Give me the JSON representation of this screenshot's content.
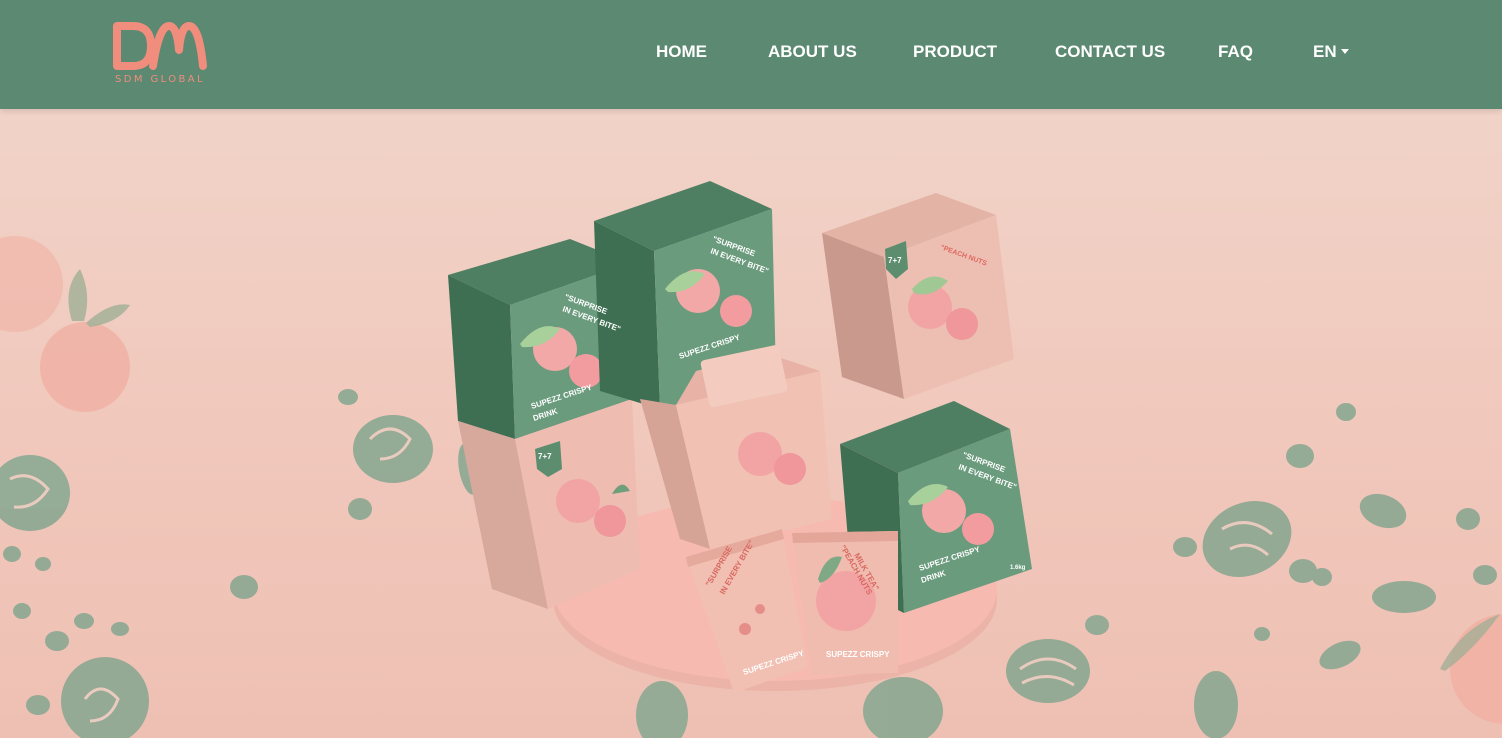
{
  "brand": {
    "logo_mark": "DM",
    "logo_text": "SDM GLOBAL",
    "accent_color": "#f08d7d",
    "nav_color": "#5b8971"
  },
  "nav": {
    "home": "HOME",
    "about": "ABOUT US",
    "product": "PRODUCT",
    "contact": "CONTACT US",
    "faq": "FAQ",
    "language": "EN"
  },
  "hero": {
    "box_text": {
      "slogan_1": "\"SURPRISE",
      "slogan_2": "IN EVERY BITE\"",
      "drink_1": "SUPEZZ CRISPY",
      "drink_2": "DRINK",
      "tag": "7+7",
      "sachet_1": "\"PEACH NUTS",
      "sachet_2": "MILK TEA\"",
      "small": "1.6kg"
    }
  }
}
